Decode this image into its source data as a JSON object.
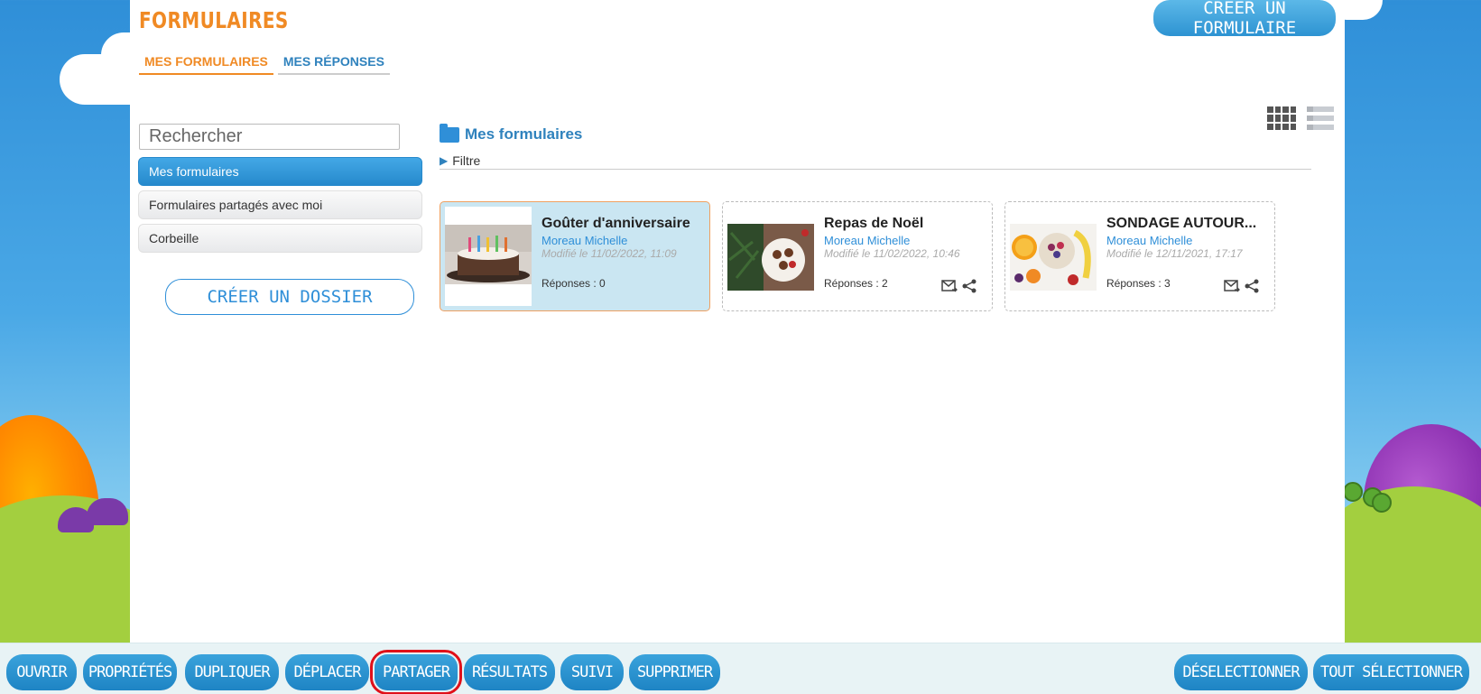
{
  "app": {
    "title": "FORMULAIRES",
    "create_form_label": "CRÉER UN FORMULAIRE"
  },
  "tabs": [
    {
      "label": "MES FORMULAIRES",
      "active": true
    },
    {
      "label": "MES RÉPONSES",
      "active": false
    }
  ],
  "sidebar": {
    "search_placeholder": "Rechercher",
    "items": [
      {
        "label": "Mes formulaires",
        "active": true
      },
      {
        "label": "Formulaires partagés avec moi",
        "active": false
      },
      {
        "label": "Corbeille",
        "active": false
      }
    ],
    "create_folder_label": "CRÉER UN DOSSIER"
  },
  "main": {
    "section_title": "Mes formulaires",
    "filter_label": "Filtre",
    "view_modes": [
      "grid-icon",
      "list-icon"
    ],
    "cards": [
      {
        "title": "Goûter d'anniversaire",
        "author": "Moreau Michelle",
        "modified": "Modifié le 11/02/2022, 11:09",
        "responses": "Réponses : 0",
        "selected": true
      },
      {
        "title": "Repas de Noël",
        "author": "Moreau Michelle",
        "modified": "Modifié le 11/02/2022, 10:46",
        "responses": "Réponses : 2",
        "selected": false
      },
      {
        "title": "SONDAGE AUTOUR...",
        "author": "Moreau Michelle",
        "modified": "Modifié le 12/11/2021, 17:17",
        "responses": "Réponses : 3",
        "selected": false
      }
    ]
  },
  "toolbar": {
    "open": "OUVRIR",
    "properties": "PROPRIÉTÉS",
    "duplicate": "DUPLIQUER",
    "move": "DÉPLACER",
    "share": "PARTAGER",
    "results": "RÉSULTATS",
    "tracking": "SUIVI",
    "delete": "SUPPRIMER",
    "deselect": "DÉSELECTIONNER",
    "select_all": "TOUT SÉLECTIONNER"
  },
  "colors": {
    "accent_orange": "#f08a24",
    "accent_blue": "#2f8fd8",
    "highlight_red": "#e0101a"
  }
}
